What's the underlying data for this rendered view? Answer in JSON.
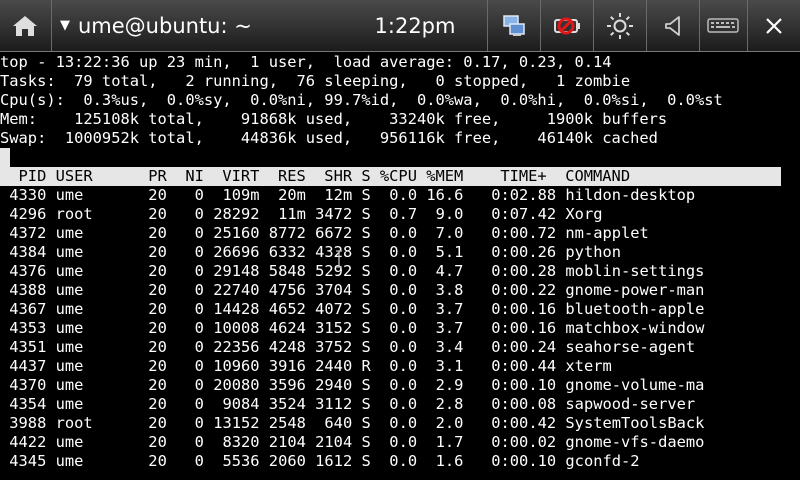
{
  "statusbar": {
    "title": "ume@ubuntu: ~",
    "time": "1:22pm",
    "icons": [
      "home-icon",
      "network-icon",
      "battery-icon",
      "brightness-icon",
      "volume-icon",
      "keyboard-icon",
      "close-icon"
    ]
  },
  "top": {
    "summary": [
      "top - 13:22:36 up 23 min,  1 user,  load average: 0.17, 0.23, 0.14",
      "Tasks:  79 total,   2 running,  76 sleeping,   0 stopped,   1 zombie",
      "Cpu(s):  0.3%us,  0.0%sy,  0.0%ni, 99.7%id,  0.0%wa,  0.0%hi,  0.0%si,  0.0%st",
      "Mem:    125108k total,    91868k used,    33240k free,     1900k buffers",
      "Swap:  1000952k total,    44836k used,   956116k free,    46140k cached"
    ],
    "header": "  PID USER      PR  NI  VIRT  RES  SHR S %CPU %MEM    TIME+  COMMAND",
    "processes": [
      {
        "pid": "4330",
        "user": "ume",
        "pr": "20",
        "ni": "0",
        "virt": "109m",
        "res": "20m",
        "shr": "12m",
        "s": "S",
        "cpu": "0.0",
        "mem": "16.6",
        "time": "0:02.88",
        "command": "hildon-desktop"
      },
      {
        "pid": "4296",
        "user": "root",
        "pr": "20",
        "ni": "0",
        "virt": "28292",
        "res": "11m",
        "shr": "3472",
        "s": "S",
        "cpu": "0.7",
        "mem": "9.0",
        "time": "0:07.42",
        "command": "Xorg"
      },
      {
        "pid": "4372",
        "user": "ume",
        "pr": "20",
        "ni": "0",
        "virt": "25160",
        "res": "8772",
        "shr": "6672",
        "s": "S",
        "cpu": "0.0",
        "mem": "7.0",
        "time": "0:00.72",
        "command": "nm-applet"
      },
      {
        "pid": "4384",
        "user": "ume",
        "pr": "20",
        "ni": "0",
        "virt": "26696",
        "res": "6332",
        "shr": "4328",
        "s": "S",
        "cpu": "0.0",
        "mem": "5.1",
        "time": "0:00.26",
        "command": "python"
      },
      {
        "pid": "4376",
        "user": "ume",
        "pr": "20",
        "ni": "0",
        "virt": "29148",
        "res": "5848",
        "shr": "5292",
        "s": "S",
        "cpu": "0.0",
        "mem": "4.7",
        "time": "0:00.28",
        "command": "moblin-settings"
      },
      {
        "pid": "4388",
        "user": "ume",
        "pr": "20",
        "ni": "0",
        "virt": "22740",
        "res": "4756",
        "shr": "3704",
        "s": "S",
        "cpu": "0.0",
        "mem": "3.8",
        "time": "0:00.22",
        "command": "gnome-power-man"
      },
      {
        "pid": "4367",
        "user": "ume",
        "pr": "20",
        "ni": "0",
        "virt": "14428",
        "res": "4652",
        "shr": "4072",
        "s": "S",
        "cpu": "0.0",
        "mem": "3.7",
        "time": "0:00.16",
        "command": "bluetooth-apple"
      },
      {
        "pid": "4353",
        "user": "ume",
        "pr": "20",
        "ni": "0",
        "virt": "10008",
        "res": "4624",
        "shr": "3152",
        "s": "S",
        "cpu": "0.0",
        "mem": "3.7",
        "time": "0:00.16",
        "command": "matchbox-window"
      },
      {
        "pid": "4351",
        "user": "ume",
        "pr": "20",
        "ni": "0",
        "virt": "22356",
        "res": "4248",
        "shr": "3752",
        "s": "S",
        "cpu": "0.0",
        "mem": "3.4",
        "time": "0:00.24",
        "command": "seahorse-agent"
      },
      {
        "pid": "4437",
        "user": "ume",
        "pr": "20",
        "ni": "0",
        "virt": "10960",
        "res": "3916",
        "shr": "2440",
        "s": "R",
        "cpu": "0.0",
        "mem": "3.1",
        "time": "0:00.44",
        "command": "xterm"
      },
      {
        "pid": "4370",
        "user": "ume",
        "pr": "20",
        "ni": "0",
        "virt": "20080",
        "res": "3596",
        "shr": "2940",
        "s": "S",
        "cpu": "0.0",
        "mem": "2.9",
        "time": "0:00.10",
        "command": "gnome-volume-ma"
      },
      {
        "pid": "4354",
        "user": "ume",
        "pr": "20",
        "ni": "0",
        "virt": "9084",
        "res": "3524",
        "shr": "3112",
        "s": "S",
        "cpu": "0.0",
        "mem": "2.8",
        "time": "0:00.08",
        "command": "sapwood-server"
      },
      {
        "pid": "3988",
        "user": "root",
        "pr": "20",
        "ni": "0",
        "virt": "13152",
        "res": "2548",
        "shr": "640",
        "s": "S",
        "cpu": "0.0",
        "mem": "2.0",
        "time": "0:00.42",
        "command": "SystemToolsBack"
      },
      {
        "pid": "4422",
        "user": "ume",
        "pr": "20",
        "ni": "0",
        "virt": "8320",
        "res": "2104",
        "shr": "2104",
        "s": "S",
        "cpu": "0.0",
        "mem": "1.7",
        "time": "0:00.02",
        "command": "gnome-vfs-daemo"
      },
      {
        "pid": "4345",
        "user": "ume",
        "pr": "20",
        "ni": "0",
        "virt": "5536",
        "res": "2060",
        "shr": "1612",
        "s": "S",
        "cpu": "0.0",
        "mem": "1.6",
        "time": "0:00.10",
        "command": "gconfd-2"
      }
    ]
  }
}
